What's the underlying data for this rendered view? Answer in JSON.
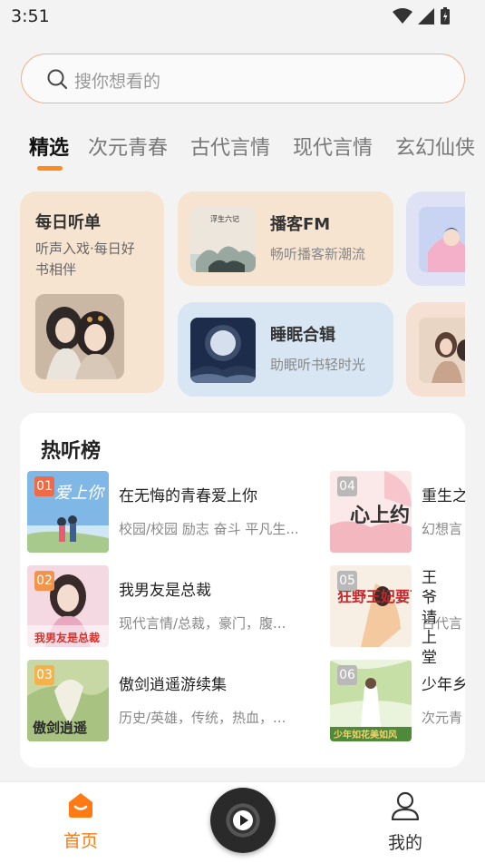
{
  "status": {
    "time": "3:51"
  },
  "search": {
    "placeholder": "搜你想看的"
  },
  "tabs": [
    {
      "label": "精选",
      "active": true
    },
    {
      "label": "次元青春"
    },
    {
      "label": "古代言情"
    },
    {
      "label": "现代言情"
    },
    {
      "label": "玄幻仙侠"
    }
  ],
  "cards": {
    "daily": {
      "title": "每日听单",
      "subtitle": "听声入戏·每日好书相伴"
    },
    "podcast": {
      "title": "播客FM",
      "subtitle": "畅听播客新潮流",
      "cover_text": "浮生六记"
    },
    "sleep": {
      "title": "睡眠合辑",
      "subtitle": "助眠听书轻时光"
    }
  },
  "hot_list": {
    "title": "热听榜",
    "items": [
      {
        "rank": "01",
        "name": "在无悔的青春爱上你",
        "tags": "校园/校园 励志 奋斗 平凡生...",
        "cover_text": "爱上你"
      },
      {
        "rank": "02",
        "name": "我男友是总裁",
        "tags": "现代言情/总裁，豪门，腹...",
        "cover_text": "我男友是总裁"
      },
      {
        "rank": "03",
        "name": "傲剑逍遥游续集",
        "tags": "历史/英雄，传统，热血，...",
        "cover_text": "傲剑逍遥"
      },
      {
        "rank": "04",
        "name": "重生之",
        "tags": "幻想言",
        "cover_text": "心上约"
      },
      {
        "rank": "05",
        "name": "王爷请上堂",
        "tags": "古代言",
        "cover_text": "狂野王妃要下堂"
      },
      {
        "rank": "06",
        "name": "少年乡",
        "tags": "次元青",
        "cover_text": "少年如花美如风"
      }
    ]
  },
  "nav": {
    "home_label": "首页",
    "mine_label": "我的"
  },
  "colors": {
    "accent": "#ff7a14",
    "search_border": "#f3b08a",
    "card_warm": "#f6e4d1",
    "card_blue": "#d8e6f3"
  }
}
